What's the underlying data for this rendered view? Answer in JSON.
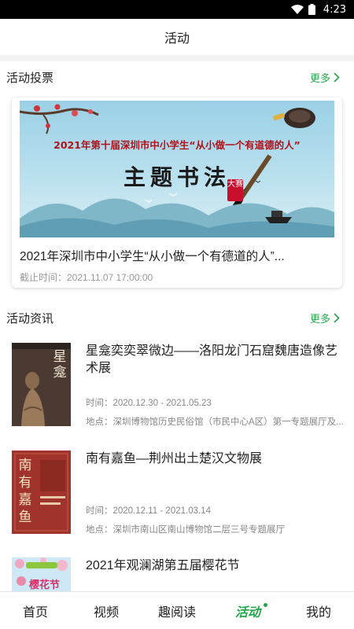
{
  "status_bar": {
    "time": "4:23"
  },
  "header": {
    "title": "活动"
  },
  "vote_section": {
    "title": "活动投票",
    "more_label": "更多",
    "card": {
      "banner_headline": "2021年第十届深圳市中小学生“从小做一个有道德的人”",
      "banner_calligraphy": "主题书法",
      "banner_stamp": "大赛",
      "title": "2021年深圳市中小学生“从小做一个有德道的人”...",
      "deadline": "截止时间：2021.11.07 17:00:00"
    }
  },
  "news_section": {
    "title": "活动资讯",
    "more_label": "更多",
    "items": [
      {
        "title": "星龛奕奕翠微边——洛阳龙门石窟魏唐造像艺术展",
        "time": "时间：2020.12.30 - 2021.05.23",
        "place": "地点：深圳博物馆历史民俗馆（市民中心A区）第一专题展厅及...",
        "thumb_text": "星龛"
      },
      {
        "title": "南有嘉鱼—荆州出土楚汉文物展",
        "time": "时间：2020.12.11 - 2021.03.14",
        "place": "地点：深圳市南山区南山博物馆二层三号专题展厅",
        "thumb_text": "南有嘉鱼"
      },
      {
        "title": "2021年观澜湖第五届樱花节",
        "thumb_text": "樱花节"
      }
    ]
  },
  "bottom_nav": {
    "items": [
      {
        "label": "首页"
      },
      {
        "label": "视频"
      },
      {
        "label": "趣阅读"
      },
      {
        "label": "活动"
      },
      {
        "label": "我的"
      }
    ]
  },
  "colors": {
    "accent": "#22a84a",
    "banner_red": "#b0121b"
  },
  "icons": [
    "wifi-icon",
    "battery-icon",
    "chevron-right-icon"
  ]
}
